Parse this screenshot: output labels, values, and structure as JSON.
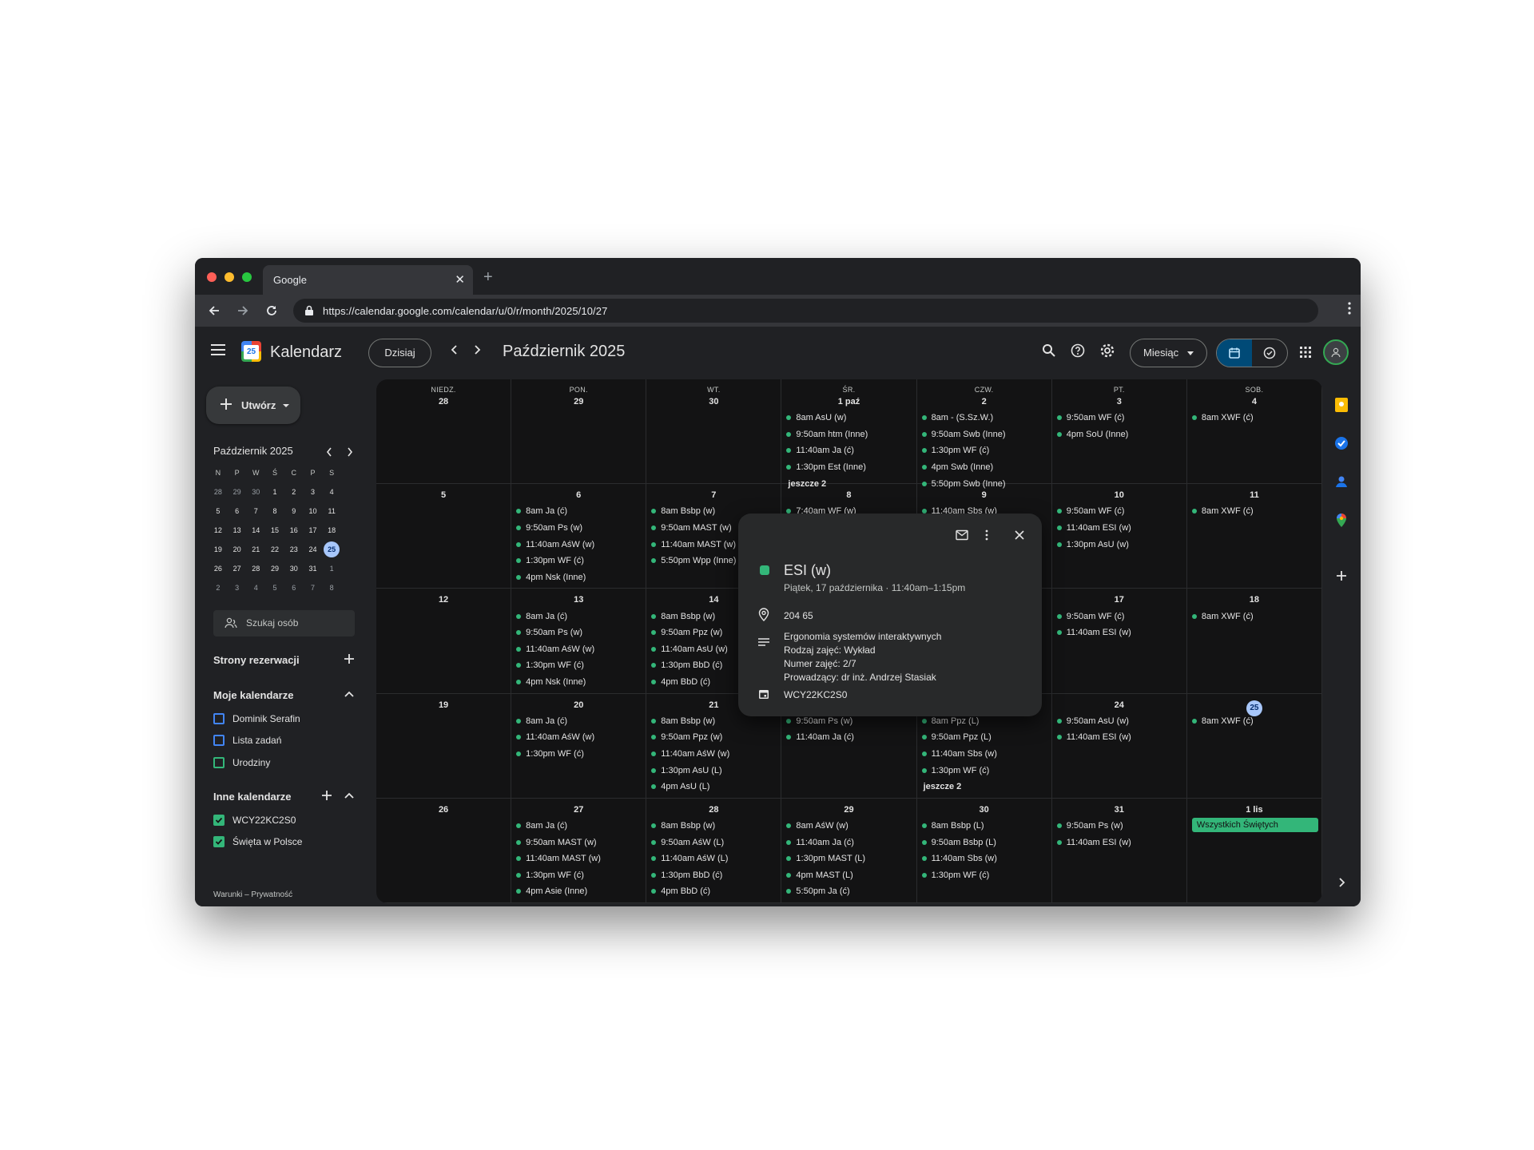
{
  "browser": {
    "tab_title": "Google",
    "url": "https://calendar.google.com/calendar/u/0/r/month/2025/10/27"
  },
  "header": {
    "app_name": "Kalendarz",
    "logo_day": "25",
    "today_label": "Dzisiaj",
    "period": "Październik 2025",
    "view_label": "Miesiąc"
  },
  "sidebar": {
    "create_label": "Utwórz",
    "mini_title": "Październik 2025",
    "mini_weekdays": [
      "N",
      "P",
      "W",
      "Ś",
      "C",
      "P",
      "S"
    ],
    "mini_weeks": [
      [
        "28",
        "29",
        "30",
        "1",
        "2",
        "3",
        "4"
      ],
      [
        "5",
        "6",
        "7",
        "8",
        "9",
        "10",
        "11"
      ],
      [
        "12",
        "13",
        "14",
        "15",
        "16",
        "17",
        "18"
      ],
      [
        "19",
        "20",
        "21",
        "22",
        "23",
        "24",
        "25"
      ],
      [
        "26",
        "27",
        "28",
        "29",
        "30",
        "31",
        "1"
      ],
      [
        "2",
        "3",
        "4",
        "5",
        "6",
        "7",
        "8"
      ]
    ],
    "search_people": "Szukaj osób",
    "booking_title": "Strony rezerwacji",
    "my_calendars_title": "Moje kalendarze",
    "my_calendars": [
      {
        "name": "Dominik Serafin",
        "color": "#4285f4",
        "checked": false
      },
      {
        "name": "Lista zadań",
        "color": "#4285f4",
        "checked": false
      },
      {
        "name": "Urodziny",
        "color": "#33b679",
        "checked": false
      }
    ],
    "other_calendars_title": "Inne kalendarze",
    "other_calendars": [
      {
        "name": "WCY22KC2S0",
        "color": "#33b679",
        "checked": true
      },
      {
        "name": "Święta w Polsce",
        "color": "#33b679",
        "checked": true
      }
    ],
    "footer": "Warunki – Prywatność"
  },
  "calendar": {
    "weekdays": [
      "NIEDZ.",
      "PON.",
      "WT.",
      "ŚR.",
      "CZW.",
      "PT.",
      "SOB."
    ],
    "weeks": [
      [
        {
          "day": "28",
          "events": []
        },
        {
          "day": "29",
          "events": []
        },
        {
          "day": "30",
          "events": []
        },
        {
          "day": "1 paź",
          "events": [
            "8am AsU (w)",
            "9:50am htm (Inne)",
            "11:40am Ja (ć)",
            "1:30pm Est (Inne)"
          ],
          "more": "jeszcze 2"
        },
        {
          "day": "2",
          "events": [
            "8am - (S.Sz.W.)",
            "9:50am Swb (Inne)",
            "1:30pm WF (ć)",
            "4pm Swb (Inne)",
            "5:50pm Swb (Inne)"
          ]
        },
        {
          "day": "3",
          "events": [
            "9:50am WF (ć)",
            "4pm SoU (Inne)"
          ]
        },
        {
          "day": "4",
          "events": [
            "8am XWF (ć)"
          ]
        }
      ],
      [
        {
          "day": "5",
          "events": []
        },
        {
          "day": "6",
          "events": [
            "8am Ja (ć)",
            "9:50am Ps (w)",
            "11:40am AśW (w)",
            "1:30pm WF (ć)",
            "4pm Nsk (Inne)"
          ]
        },
        {
          "day": "7",
          "events": [
            "8am Bsbp (w)",
            "9:50am MAST (w)",
            "11:40am MAST (w)",
            "5:50pm Wpp (Inne)"
          ]
        },
        {
          "day": "8",
          "events": [
            "7:40am WF (w)"
          ]
        },
        {
          "day": "9",
          "events": [
            "11:40am Sbs (w)"
          ]
        },
        {
          "day": "10",
          "events": [
            "9:50am WF (ć)",
            "11:40am ESI (w)",
            "1:30pm AsU (w)"
          ]
        },
        {
          "day": "11",
          "events": [
            "8am XWF (ć)"
          ]
        }
      ],
      [
        {
          "day": "12",
          "events": []
        },
        {
          "day": "13",
          "events": [
            "8am Ja (ć)",
            "9:50am Ps (w)",
            "11:40am AśW (w)",
            "1:30pm WF (ć)",
            "4pm Nsk (Inne)"
          ]
        },
        {
          "day": "14",
          "events": [
            "8am Bsbp (w)",
            "9:50am Ppz (w)",
            "11:40am AsU (w)",
            "1:30pm BbD (ć)",
            "4pm BbD (ć)"
          ]
        },
        {
          "day": "15",
          "events": []
        },
        {
          "day": "16",
          "events": []
        },
        {
          "day": "17",
          "events": [
            "9:50am WF (ć)",
            "11:40am ESI (w)"
          ]
        },
        {
          "day": "18",
          "events": [
            "8am XWF (ć)"
          ]
        }
      ],
      [
        {
          "day": "19",
          "events": []
        },
        {
          "day": "20",
          "events": [
            "8am Ja (ć)",
            "11:40am AśW (w)",
            "1:30pm WF (ć)"
          ]
        },
        {
          "day": "21",
          "events": [
            "8am Bsbp (w)",
            "9:50am Ppz (w)",
            "11:40am AśW (w)",
            "1:30pm AsU (L)",
            "4pm AsU (L)"
          ]
        },
        {
          "day": "22",
          "events": [
            "9:50am Ps (w)",
            "11:40am Ja (ć)"
          ]
        },
        {
          "day": "23",
          "events": [
            "8am Ppz (L)",
            "9:50am Ppz (L)",
            "11:40am Sbs (w)",
            "1:30pm WF (ć)"
          ],
          "more": "jeszcze 2"
        },
        {
          "day": "24",
          "events": [
            "9:50am AsU (w)",
            "11:40am ESI (w)"
          ]
        },
        {
          "day": "25",
          "events": [
            "8am XWF (ć)"
          ],
          "today": true
        }
      ],
      [
        {
          "day": "26",
          "events": []
        },
        {
          "day": "27",
          "events": [
            "8am Ja (ć)",
            "9:50am MAST (w)",
            "11:40am MAST (w)",
            "1:30pm WF (ć)",
            "4pm Asie (Inne)"
          ]
        },
        {
          "day": "28",
          "events": [
            "8am Bsbp (w)",
            "9:50am AśW (L)",
            "11:40am AśW (L)",
            "1:30pm BbD (ć)",
            "4pm BbD (ć)"
          ]
        },
        {
          "day": "29",
          "events": [
            "8am AśW (w)",
            "11:40am Ja (ć)",
            "1:30pm MAST (L)",
            "4pm MAST (L)",
            "5:50pm Ja (ć)"
          ]
        },
        {
          "day": "30",
          "events": [
            "8am Bsbp (L)",
            "9:50am Bsbp (L)",
            "11:40am Sbs (w)",
            "1:30pm WF (ć)"
          ]
        },
        {
          "day": "31",
          "events": [
            "9:50am Ps (w)",
            "11:40am ESI (w)"
          ]
        },
        {
          "day": "1 lis",
          "events": [],
          "allday": "Wszystkich Świętych"
        }
      ]
    ]
  },
  "popup": {
    "title": "ESI (w)",
    "datetime": "Piątek, 17 października  ·  11:40am–1:15pm",
    "location": "204 65",
    "description": [
      "Ergonomia systemów interaktywnych",
      "Rodzaj zajęć: Wykład",
      "Numer zajęć: 2/7",
      "Prowadzący: dr inż. Andrzej Stasiak"
    ],
    "calendar": "WCY22KC2S0"
  },
  "colors": {
    "event": "#33b679",
    "today_bg": "#a8c7fa",
    "accent": "#004a77"
  }
}
